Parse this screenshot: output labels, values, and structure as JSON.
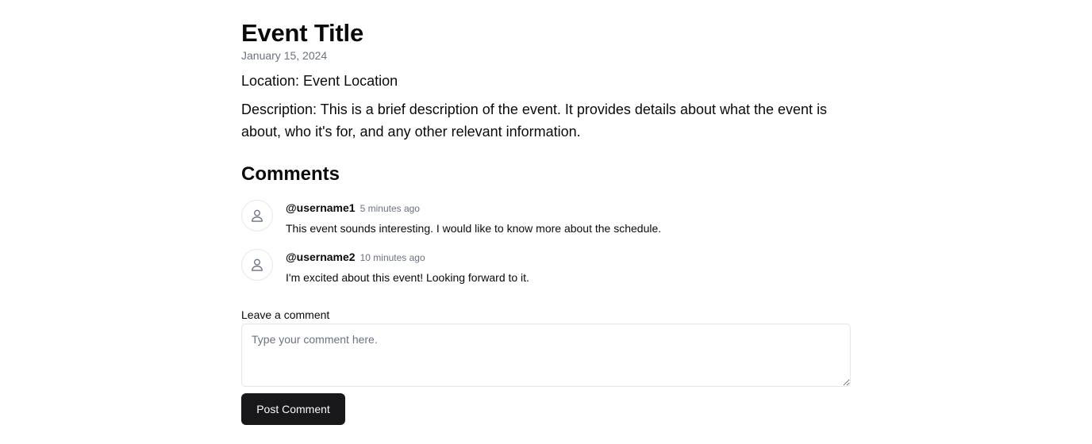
{
  "event": {
    "title": "Event Title",
    "date": "January 15, 2024",
    "location": "Location: Event Location",
    "description": "Description: This is a brief description of the event. It provides details about what the event is about, who it's for, and any other relevant information."
  },
  "comments": {
    "heading": "Comments",
    "items": [
      {
        "username": "@username1",
        "time": "5 minutes ago",
        "text": "This event sounds interesting. I would like to know more about the schedule.",
        "avatar_icon": "user-icon"
      },
      {
        "username": "@username2",
        "time": "10 minutes ago",
        "text": "I'm excited about this event! Looking forward to it.",
        "avatar_icon": "user-icon"
      }
    ]
  },
  "form": {
    "label": "Leave a comment",
    "placeholder": "Type your comment here.",
    "value": "",
    "submit_label": "Post Comment"
  },
  "colors": {
    "text": "#0a0a0a",
    "muted": "#6b7280",
    "border": "#e5e7eb",
    "button_bg": "#18181b",
    "button_text": "#fafafa"
  }
}
